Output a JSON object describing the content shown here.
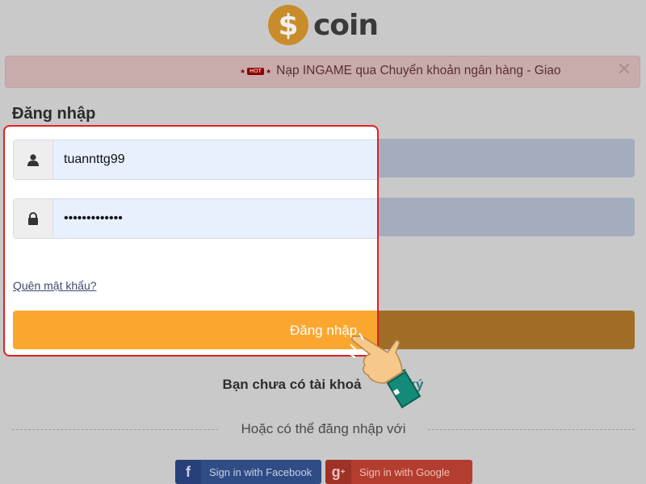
{
  "brand": {
    "logo_symbol": "$",
    "logo_text": "coin",
    "coin_color": "#c98c2a"
  },
  "alert": {
    "hot_label": "HOT",
    "text": "Nạp INGAME qua Chuyển khoản ngân hàng - Giao",
    "close_icon": "close-icon"
  },
  "login": {
    "title": "Đăng nhập",
    "username_value": "tuannttg99",
    "username_icon": "user-icon",
    "password_value": "•••••••••••••",
    "password_icon": "lock-icon",
    "forgot_password": "Quên mật khẩu?",
    "submit_label": "Đăng nhập"
  },
  "signup": {
    "prompt": "Bạn chưa có tài khoả",
    "link": "ký"
  },
  "social": {
    "divider_text": "Hoặc có thể đăng nhập với",
    "facebook_label": "Sign in with Facebook",
    "google_label": "Sign in with Google"
  },
  "colors": {
    "accent_orange": "#fba72f",
    "highlight_border": "#e02020",
    "facebook": "#2f4c87",
    "google": "#b33d2e"
  }
}
